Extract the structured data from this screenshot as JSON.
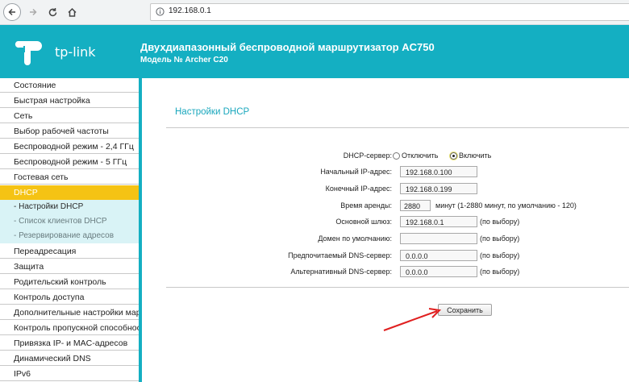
{
  "browser": {
    "url": "192.168.0.1",
    "icons": [
      "back-icon",
      "forward-icon",
      "reload-icon",
      "home-icon",
      "info-icon"
    ]
  },
  "header": {
    "logo_text": "tp-link",
    "title": "Двухдиапазонный беспроводной маршрутизатор AC750",
    "model": "Модель № Archer C20",
    "color": "#14afc2"
  },
  "sidebar": {
    "items": [
      {
        "label": "Состояние"
      },
      {
        "label": "Быстрая настройка"
      },
      {
        "label": "Сеть"
      },
      {
        "label": "Выбор рабочей частоты"
      },
      {
        "label": "Беспроводной режим - 2,4 ГГц"
      },
      {
        "label": "Беспроводной режим - 5 ГГц"
      },
      {
        "label": "Гостевая сеть"
      },
      {
        "label": "DHCP"
      }
    ],
    "subitems": [
      {
        "label": "- Настройки DHCP"
      },
      {
        "label": "- Список клиентов DHCP"
      },
      {
        "label": "- Резервирование адресов"
      }
    ],
    "items_after": [
      {
        "label": "Переадресация"
      },
      {
        "label": "Защита"
      },
      {
        "label": "Родительский контроль"
      },
      {
        "label": "Контроль доступа"
      },
      {
        "label": "Дополнительные настройки маршрутизации"
      },
      {
        "label": "Контроль пропускной способности"
      },
      {
        "label": "Привязка IP- и MAC-адресов"
      },
      {
        "label": "Динамический DNS"
      },
      {
        "label": "IPv6"
      }
    ],
    "active_color": "#f5c314"
  },
  "main": {
    "section_title": "Настройки DHCP",
    "server_label": "DHCP-сервер:",
    "server_off": "Отключить",
    "server_on": "Включить",
    "server_value": "Включить",
    "start_label": "Начальный IP-адрес:",
    "start_value": "192.168.0.100",
    "end_label": "Конечный IP-адрес:",
    "end_value": "192.168.0.199",
    "lease_label": "Время аренды:",
    "lease_value": "2880",
    "lease_hint": "минут (1-2880 минут, по умолчанию - 120)",
    "gateway_label": "Основной шлюз:",
    "gateway_value": "192.168.0.1",
    "domain_label": "Домен по умолчанию:",
    "domain_value": "",
    "dns1_label": "Предпочитаемый DNS-сервер:",
    "dns1_value": "0.0.0.0",
    "dns2_label": "Альтернативный DNS-сервер:",
    "dns2_value": "0.0.0.0",
    "optional_hint": "(по выбору)",
    "save_label": "Сохранить",
    "annotation_arrow_color": "#e02020"
  }
}
